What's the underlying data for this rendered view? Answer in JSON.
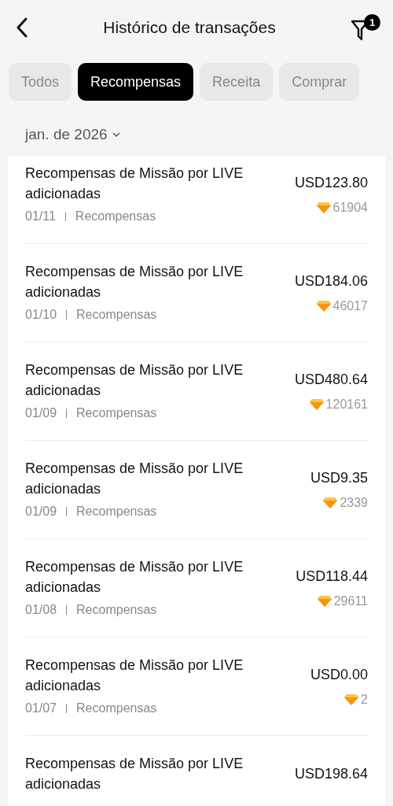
{
  "header": {
    "title": "Histórico de transações",
    "filter_badge": "1"
  },
  "tabs": [
    {
      "label": "Todos",
      "selected": false
    },
    {
      "label": "Recompensas",
      "selected": true
    },
    {
      "label": "Receita",
      "selected": false
    },
    {
      "label": "Comprar",
      "selected": false
    }
  ],
  "month_picker": {
    "label": "jan. de 2026"
  },
  "transactions": [
    {
      "title": "Recompensas de Missão por LIVE adicionadas",
      "date": "01/11",
      "category": "Recompensas",
      "amount": "USD123.80",
      "gems": "61904"
    },
    {
      "title": "Recompensas de Missão por LIVE adicionadas",
      "date": "01/10",
      "category": "Recompensas",
      "amount": "USD184.06",
      "gems": "46017"
    },
    {
      "title": "Recompensas de Missão por LIVE adicionadas",
      "date": "01/09",
      "category": "Recompensas",
      "amount": "USD480.64",
      "gems": "120161"
    },
    {
      "title": "Recompensas de Missão por LIVE adicionadas",
      "date": "01/09",
      "category": "Recompensas",
      "amount": "USD9.35",
      "gems": "2339"
    },
    {
      "title": "Recompensas de Missão por LIVE adicionadas",
      "date": "01/08",
      "category": "Recompensas",
      "amount": "USD118.44",
      "gems": "29611"
    },
    {
      "title": "Recompensas de Missão por LIVE adicionadas",
      "date": "01/07",
      "category": "Recompensas",
      "amount": "USD0.00",
      "gems": "2"
    },
    {
      "title": "Recompensas de Missão por LIVE adicionadas",
      "amount": "USD198.64"
    }
  ]
}
